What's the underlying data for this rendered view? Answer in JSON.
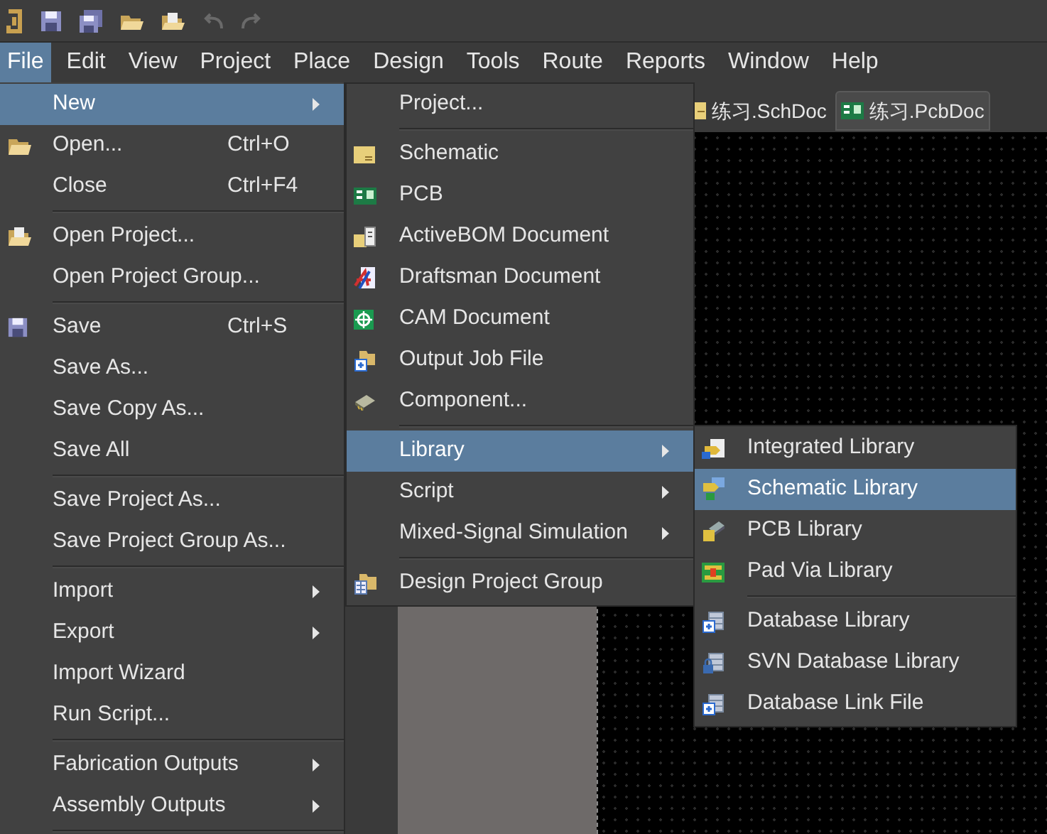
{
  "menu_bar": [
    {
      "label": "File",
      "selected": true
    },
    {
      "label": "Edit",
      "selected": false
    },
    {
      "label": "View",
      "selected": false
    },
    {
      "label": "Project",
      "selected": false
    },
    {
      "label": "Place",
      "selected": false
    },
    {
      "label": "Design",
      "selected": false
    },
    {
      "label": "Tools",
      "selected": false
    },
    {
      "label": "Route",
      "selected": false
    },
    {
      "label": "Reports",
      "selected": false
    },
    {
      "label": "Window",
      "selected": false
    },
    {
      "label": "Help",
      "selected": false
    }
  ],
  "document_tabs": [
    {
      "label": "练习.SchDoc",
      "selected": false
    },
    {
      "label": "练习.PcbDoc",
      "selected": true
    }
  ],
  "file_menu": [
    {
      "kind": "item",
      "label": "New",
      "submenu": true,
      "selected": true
    },
    {
      "kind": "item",
      "label": "Open...",
      "shortcut": "Ctrl+O",
      "submenu": false,
      "selected": false
    },
    {
      "kind": "item",
      "label": "Close",
      "shortcut": "Ctrl+F4",
      "submenu": false,
      "selected": false
    },
    {
      "kind": "separator"
    },
    {
      "kind": "item",
      "label": "Open Project...",
      "submenu": false,
      "selected": false
    },
    {
      "kind": "item",
      "label": "Open Project Group...",
      "submenu": false,
      "selected": false
    },
    {
      "kind": "separator"
    },
    {
      "kind": "item",
      "label": "Save",
      "shortcut": "Ctrl+S",
      "submenu": false,
      "selected": false
    },
    {
      "kind": "item",
      "label": "Save As...",
      "submenu": false,
      "selected": false
    },
    {
      "kind": "item",
      "label": "Save Copy As...",
      "submenu": false,
      "selected": false
    },
    {
      "kind": "item",
      "label": "Save All",
      "submenu": false,
      "selected": false
    },
    {
      "kind": "separator"
    },
    {
      "kind": "item",
      "label": "Save Project As...",
      "submenu": false,
      "selected": false
    },
    {
      "kind": "item",
      "label": "Save Project Group As...",
      "submenu": false,
      "selected": false
    },
    {
      "kind": "separator"
    },
    {
      "kind": "item",
      "label": "Import",
      "submenu": true,
      "selected": false
    },
    {
      "kind": "item",
      "label": "Export",
      "submenu": true,
      "selected": false
    },
    {
      "kind": "item",
      "label": "Import Wizard",
      "submenu": false,
      "selected": false
    },
    {
      "kind": "item",
      "label": "Run Script...",
      "submenu": false,
      "selected": false
    },
    {
      "kind": "separator"
    },
    {
      "kind": "item",
      "label": "Fabrication Outputs",
      "submenu": true,
      "selected": false
    },
    {
      "kind": "item",
      "label": "Assembly Outputs",
      "submenu": true,
      "selected": false
    },
    {
      "kind": "separator"
    }
  ],
  "new_menu": [
    {
      "kind": "item",
      "label": "Project...",
      "submenu": false,
      "selected": false
    },
    {
      "kind": "separator"
    },
    {
      "kind": "item",
      "label": "Schematic",
      "submenu": false,
      "selected": false
    },
    {
      "kind": "item",
      "label": "PCB",
      "submenu": false,
      "selected": false
    },
    {
      "kind": "item",
      "label": "ActiveBOM Document",
      "submenu": false,
      "selected": false
    },
    {
      "kind": "item",
      "label": "Draftsman Document",
      "submenu": false,
      "selected": false
    },
    {
      "kind": "item",
      "label": "CAM Document",
      "submenu": false,
      "selected": false
    },
    {
      "kind": "item",
      "label": "Output Job File",
      "submenu": false,
      "selected": false
    },
    {
      "kind": "item",
      "label": "Component...",
      "submenu": false,
      "selected": false
    },
    {
      "kind": "separator"
    },
    {
      "kind": "item",
      "label": "Library",
      "submenu": true,
      "selected": true
    },
    {
      "kind": "item",
      "label": "Script",
      "submenu": true,
      "selected": false
    },
    {
      "kind": "item",
      "label": "Mixed-Signal Simulation",
      "submenu": true,
      "selected": false
    },
    {
      "kind": "separator"
    },
    {
      "kind": "item",
      "label": "Design Project Group",
      "submenu": false,
      "selected": false
    }
  ],
  "library_menu": [
    {
      "kind": "item",
      "label": "Integrated Library",
      "submenu": false,
      "selected": false
    },
    {
      "kind": "item",
      "label": "Schematic Library",
      "submenu": false,
      "selected": true
    },
    {
      "kind": "item",
      "label": "PCB Library",
      "submenu": false,
      "selected": false
    },
    {
      "kind": "item",
      "label": "Pad Via Library",
      "submenu": false,
      "selected": false
    },
    {
      "kind": "separator"
    },
    {
      "kind": "item",
      "label": "Database Library",
      "submenu": false,
      "selected": false
    },
    {
      "kind": "item",
      "label": "SVN Database Library",
      "submenu": false,
      "selected": false
    },
    {
      "kind": "item",
      "label": "Database Link File",
      "submenu": false,
      "selected": false
    }
  ]
}
